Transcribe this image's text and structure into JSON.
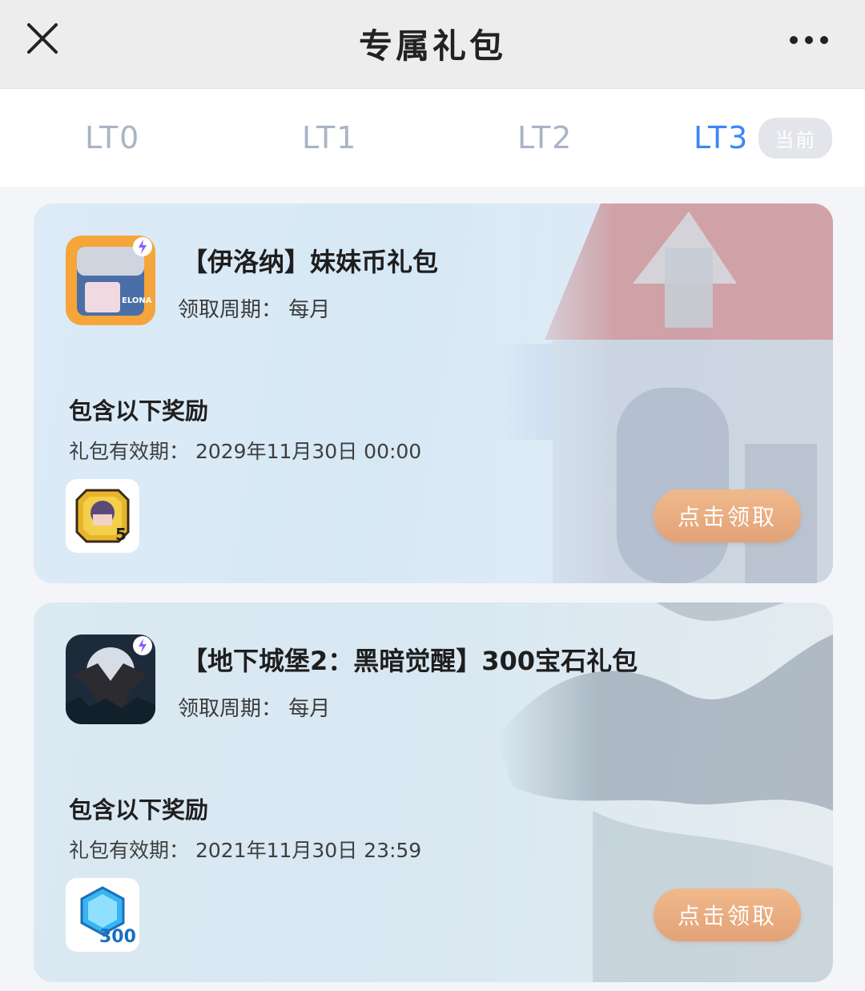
{
  "header": {
    "title": "专属礼包",
    "close_icon": "close-icon",
    "more_icon": "more-icon"
  },
  "tabs": [
    {
      "label": "LT0",
      "active": false
    },
    {
      "label": "LT1",
      "active": false
    },
    {
      "label": "LT2",
      "active": false
    },
    {
      "label": "LT3",
      "active": true,
      "badge": "当前"
    }
  ],
  "cards": [
    {
      "game_title": "【伊洛纳】妹妹币礼包",
      "period_label": "领取周期：",
      "period_value": "每月",
      "rewards_title": "包含以下奖励",
      "validity_label": "礼包有效期：",
      "validity_value": "2029年11月30日 00:00",
      "reward_icon": "coin-icon",
      "reward_count": "5",
      "claim_label": "点击领取",
      "icon_caption": "ELONA"
    },
    {
      "game_title": "【地下城堡2：黑暗觉醒】300宝石礼包",
      "period_label": "领取周期：",
      "period_value": "每月",
      "rewards_title": "包含以下奖励",
      "validity_label": "礼包有效期：",
      "validity_value": "2021年11月30日 23:59",
      "reward_icon": "gem-icon",
      "reward_count": "300",
      "claim_label": "点击领取"
    }
  ],
  "colors": {
    "accent": "#3b87f5",
    "claim_button": "#e8ac80",
    "tab_inactive": "#a9b4c6"
  }
}
